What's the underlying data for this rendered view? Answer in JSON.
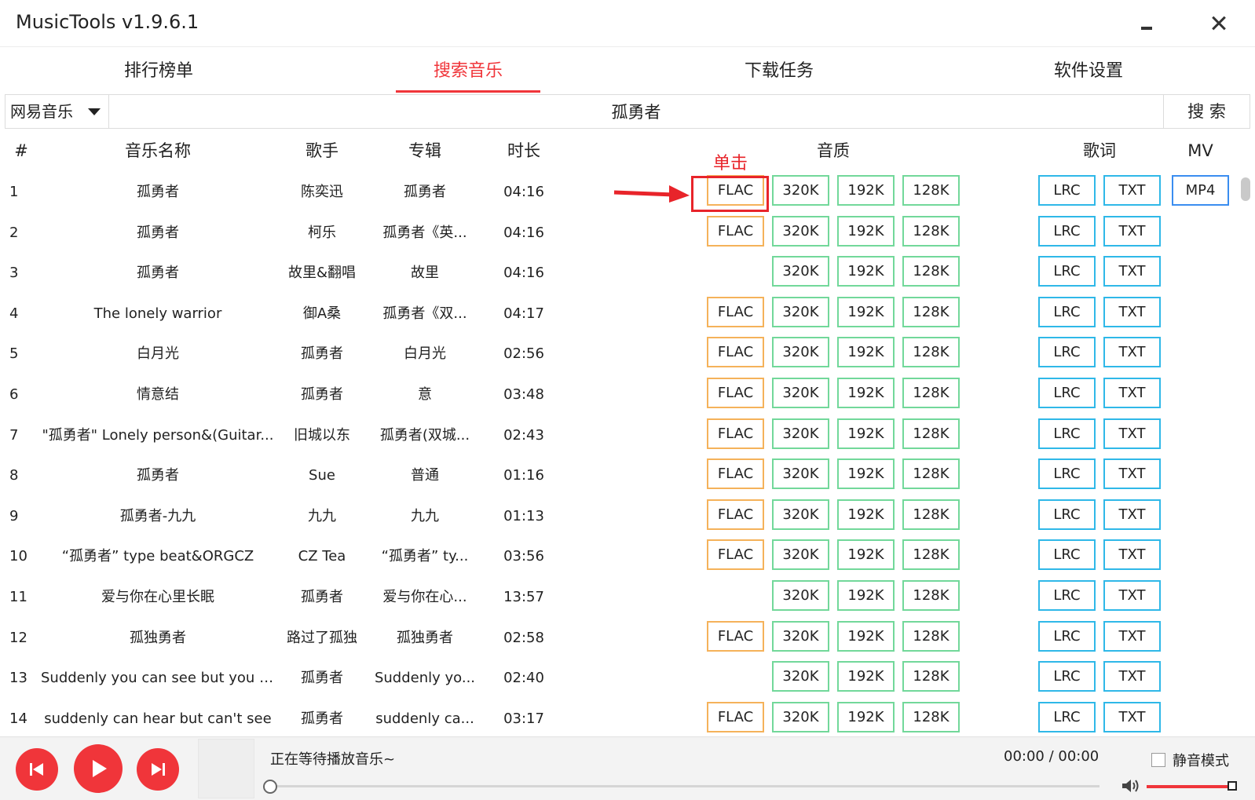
{
  "window": {
    "title": "MusicTools v1.9.6.1"
  },
  "tabs": [
    {
      "label": "排行榜单",
      "active": false
    },
    {
      "label": "搜索音乐",
      "active": true
    },
    {
      "label": "下载任务",
      "active": false
    },
    {
      "label": "软件设置",
      "active": false
    }
  ],
  "search": {
    "source": "网易音乐",
    "query": "孤勇者",
    "button": "搜 索"
  },
  "table": {
    "headers": {
      "idx": "#",
      "name": "音乐名称",
      "singer": "歌手",
      "album": "专辑",
      "duration": "时长",
      "quality": "音质",
      "lyrics": "歌词",
      "mv": "MV"
    },
    "rows": [
      {
        "idx": "1",
        "name": "孤勇者",
        "singer": "陈奕迅",
        "album": "孤勇者",
        "duration": "04:16",
        "flac": true,
        "mv": true
      },
      {
        "idx": "2",
        "name": "孤勇者",
        "singer": "柯乐",
        "album": "孤勇者《英...",
        "duration": "04:16",
        "flac": true,
        "mv": false
      },
      {
        "idx": "3",
        "name": "孤勇者",
        "singer": "故里&翻唱",
        "album": "故里",
        "duration": "04:16",
        "flac": false,
        "mv": false
      },
      {
        "idx": "4",
        "name": "The lonely warrior",
        "singer": "御A桑",
        "album": "孤勇者《双...",
        "duration": "04:17",
        "flac": true,
        "mv": false
      },
      {
        "idx": "5",
        "name": "白月光",
        "singer": "孤勇者",
        "album": "白月光",
        "duration": "02:56",
        "flac": true,
        "mv": false
      },
      {
        "idx": "6",
        "name": "情意结",
        "singer": "孤勇者",
        "album": "意",
        "duration": "03:48",
        "flac": true,
        "mv": false
      },
      {
        "idx": "7",
        "name": "\"孤勇者\" Lonely person&(Guitar...",
        "singer": "旧城以东",
        "album": "孤勇者(双城...",
        "duration": "02:43",
        "flac": true,
        "mv": false
      },
      {
        "idx": "8",
        "name": "孤勇者",
        "singer": "Sue",
        "album": "普通",
        "duration": "01:16",
        "flac": true,
        "mv": false
      },
      {
        "idx": "9",
        "name": "孤勇者-九九",
        "singer": "九九",
        "album": "九九",
        "duration": "01:13",
        "flac": true,
        "mv": false
      },
      {
        "idx": "10",
        "name": "“孤勇者” type beat&ORGCZ",
        "singer": "CZ Tea",
        "album": "“孤勇者” ty...",
        "duration": "03:56",
        "flac": true,
        "mv": false
      },
      {
        "idx": "11",
        "name": "爱与你在心里长眠",
        "singer": "孤勇者",
        "album": "爱与你在心...",
        "duration": "13:57",
        "flac": false,
        "mv": false
      },
      {
        "idx": "12",
        "name": "孤独勇者",
        "singer": "路过了孤独",
        "album": "孤独勇者",
        "duration": "02:58",
        "flac": true,
        "mv": false
      },
      {
        "idx": "13",
        "name": "Suddenly you can see but you c...",
        "singer": "孤勇者",
        "album": "Suddenly yo...",
        "duration": "02:40",
        "flac": false,
        "mv": false
      },
      {
        "idx": "14",
        "name": "suddenly can hear but can't see",
        "singer": "孤勇者",
        "album": "suddenly ca...",
        "duration": "03:17",
        "flac": true,
        "mv": false
      }
    ],
    "quality_labels": {
      "flac": "FLAC",
      "q320": "320K",
      "q192": "192K",
      "q128": "128K"
    },
    "lyric_labels": {
      "lrc": "LRC",
      "txt": "TXT"
    },
    "mv_label": "MP4"
  },
  "annotation": {
    "label": "单击",
    "color": "#e8242a"
  },
  "player": {
    "status": "正在等待播放音乐~",
    "time": "00:00 / 00:00",
    "mute_label": "静音模式",
    "mute_checked": false,
    "progress": 0,
    "volume": 1.0
  },
  "colors": {
    "accent": "#f0353a",
    "flac_border": "#f5b25a",
    "bitrate_border": "#72d89a",
    "lyric_border": "#2fb8e8",
    "mv_border": "#3a8df0"
  },
  "icons": {
    "prev": "skip-previous-icon",
    "play": "play-icon",
    "next": "skip-next-icon",
    "volume": "volume-icon",
    "minimize": "minimize-icon",
    "close": "close-icon",
    "dropdown": "caret-down-icon"
  }
}
